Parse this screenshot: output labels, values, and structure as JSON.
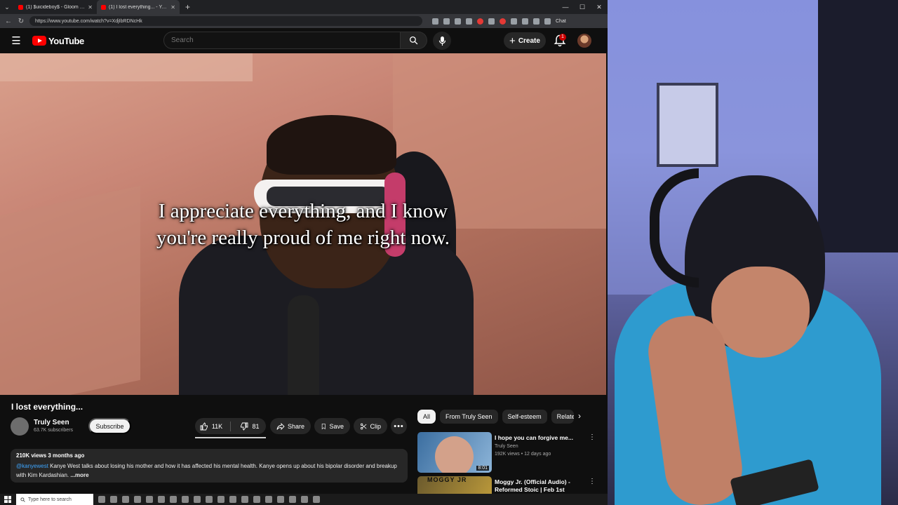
{
  "browser": {
    "tabs": [
      {
        "title": "(1) $uicideboy$ - Gloom - YouTube"
      },
      {
        "title": "(1) I lost everything... - YouTube"
      }
    ],
    "url": "https://www.youtube.com/watch?v=XdjIbRDNcHk",
    "ext_label": "Chat",
    "new_tab": "+"
  },
  "header": {
    "logo_text": "YouTube",
    "search_placeholder": "Search",
    "create_label": "Create",
    "notification_count": "1"
  },
  "video": {
    "caption_line1": "I appreciate everything, and I know",
    "caption_line2": "you're really proud of me right now."
  },
  "info": {
    "title": "I lost everything...",
    "channel": "Truly Seen",
    "subscribers": "63.7K subscribers",
    "subscribe_label": "Subscribe",
    "likes": "11K",
    "dislikes": "81",
    "share_label": "Share",
    "save_label": "Save",
    "clip_label": "Clip"
  },
  "description": {
    "meta": "210K views  3 months ago",
    "mention": "@kanyewest",
    "text": " Kanye West talks about losing his mother and how it has affected his mental health. Kanye opens up about his bipolar disorder and breakup with Kim Kardashian. ",
    "more": "...more"
  },
  "chips": [
    "All",
    "From Truly Seen",
    "Self-esteem",
    "Related"
  ],
  "recommendations": [
    {
      "title": "I hope you can forgive me...",
      "channel": "Truly Seen",
      "meta": "192K views • 12 days ago",
      "duration": "8:01"
    },
    {
      "title": "Moggy Jr. (Official Audio) - Reformed Stoic | Feb 1st",
      "thumb_label": "MOGGY JR"
    }
  ],
  "taskbar": {
    "search_placeholder": "Type here to search"
  }
}
